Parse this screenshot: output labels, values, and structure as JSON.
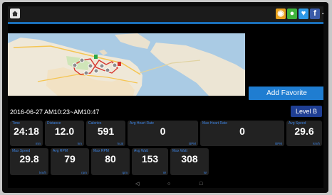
{
  "topbar": {
    "home_icon": "home-icon",
    "share": [
      {
        "name": "weibo",
        "glyph": "◉"
      },
      {
        "name": "wechat",
        "glyph": "●"
      },
      {
        "name": "twitter",
        "glyph": "♥"
      },
      {
        "name": "facebook",
        "glyph": "f"
      },
      {
        "name": "add",
        "glyph": "+"
      }
    ]
  },
  "colors": {
    "accent": "#1a6fb8",
    "button": "#1f7dd1",
    "level": "#1f3e93",
    "card": "#222222",
    "label": "#3c82e0"
  },
  "actions": {
    "add_favorite": "Add Favorite",
    "level": "Level B"
  },
  "session": {
    "datetime": "2016-06-27 AM10:23~AM10:47"
  },
  "stats_row1": [
    {
      "label": "Time",
      "value": "24:18",
      "unit": "min"
    },
    {
      "label": "Distance",
      "value": "12.0",
      "unit": "km"
    },
    {
      "label": "Calories",
      "value": "591",
      "unit": "kcal"
    },
    {
      "label": "Avg Heart Rate",
      "value": "0",
      "unit": "BPM"
    },
    {
      "label": "Max Heart Rate",
      "value": "0",
      "unit": "BPM"
    },
    {
      "label": "Avg Speed",
      "value": "29.6",
      "unit": "km/h"
    }
  ],
  "stats_row2": [
    {
      "label": "Max Speed",
      "value": "29.8",
      "unit": "km/h"
    },
    {
      "label": "Avg RPM",
      "value": "79",
      "unit": "rpm"
    },
    {
      "label": "Max RPM",
      "value": "80",
      "unit": "rpm"
    },
    {
      "label": "Avg Watt",
      "value": "153",
      "unit": "W"
    },
    {
      "label": "Max Watt",
      "value": "308",
      "unit": "W"
    }
  ],
  "nav": {
    "back": "◁",
    "home": "○",
    "recent": "□"
  }
}
